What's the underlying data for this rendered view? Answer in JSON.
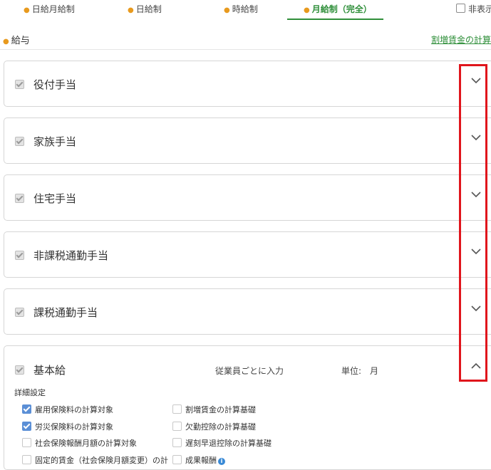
{
  "tabs": [
    {
      "label": "日給月給制",
      "active": false
    },
    {
      "label": "日給制",
      "active": false
    },
    {
      "label": "時給制",
      "active": false
    },
    {
      "label": "月給制（完全）",
      "active": true
    }
  ],
  "hide_toggle": {
    "label": "非表示",
    "checked": false
  },
  "section": {
    "title": "給与",
    "link": "割増賃金の計算基"
  },
  "allowances": [
    {
      "label": "役付手当",
      "expanded": false
    },
    {
      "label": "家族手当",
      "expanded": false
    },
    {
      "label": "住宅手当",
      "expanded": false
    },
    {
      "label": "非課税通勤手当",
      "expanded": false
    },
    {
      "label": "課税通勤手当",
      "expanded": false
    }
  ],
  "base_salary": {
    "label": "基本給",
    "input_mode": "従業員ごとに入力",
    "unit_label": "単位:",
    "unit_value": "月",
    "expanded": true,
    "detail_title": "詳細設定",
    "options_left": [
      {
        "label": "雇用保険料の計算対象",
        "checked": true
      },
      {
        "label": "労災保険料の計算対象",
        "checked": true
      },
      {
        "label": "社会保険報酬月額の計算対象",
        "checked": false
      },
      {
        "label": "固定的賃金（社会保険月額変更）の計",
        "checked": false
      }
    ],
    "options_right": [
      {
        "label": "割増賃金の計算基礎",
        "checked": false
      },
      {
        "label": "欠勤控除の計算基礎",
        "checked": false
      },
      {
        "label": "遅刻早退控除の計算基礎",
        "checked": false
      },
      {
        "label": "成果報酬",
        "checked": false,
        "info_icon": "info-icon"
      }
    ]
  },
  "colors": {
    "accent_green": "#2f8f3a",
    "tab_dot_orange": "#e89a1e",
    "checkbox_blue": "#5b8fd6",
    "highlight_red": "#e0151c"
  }
}
